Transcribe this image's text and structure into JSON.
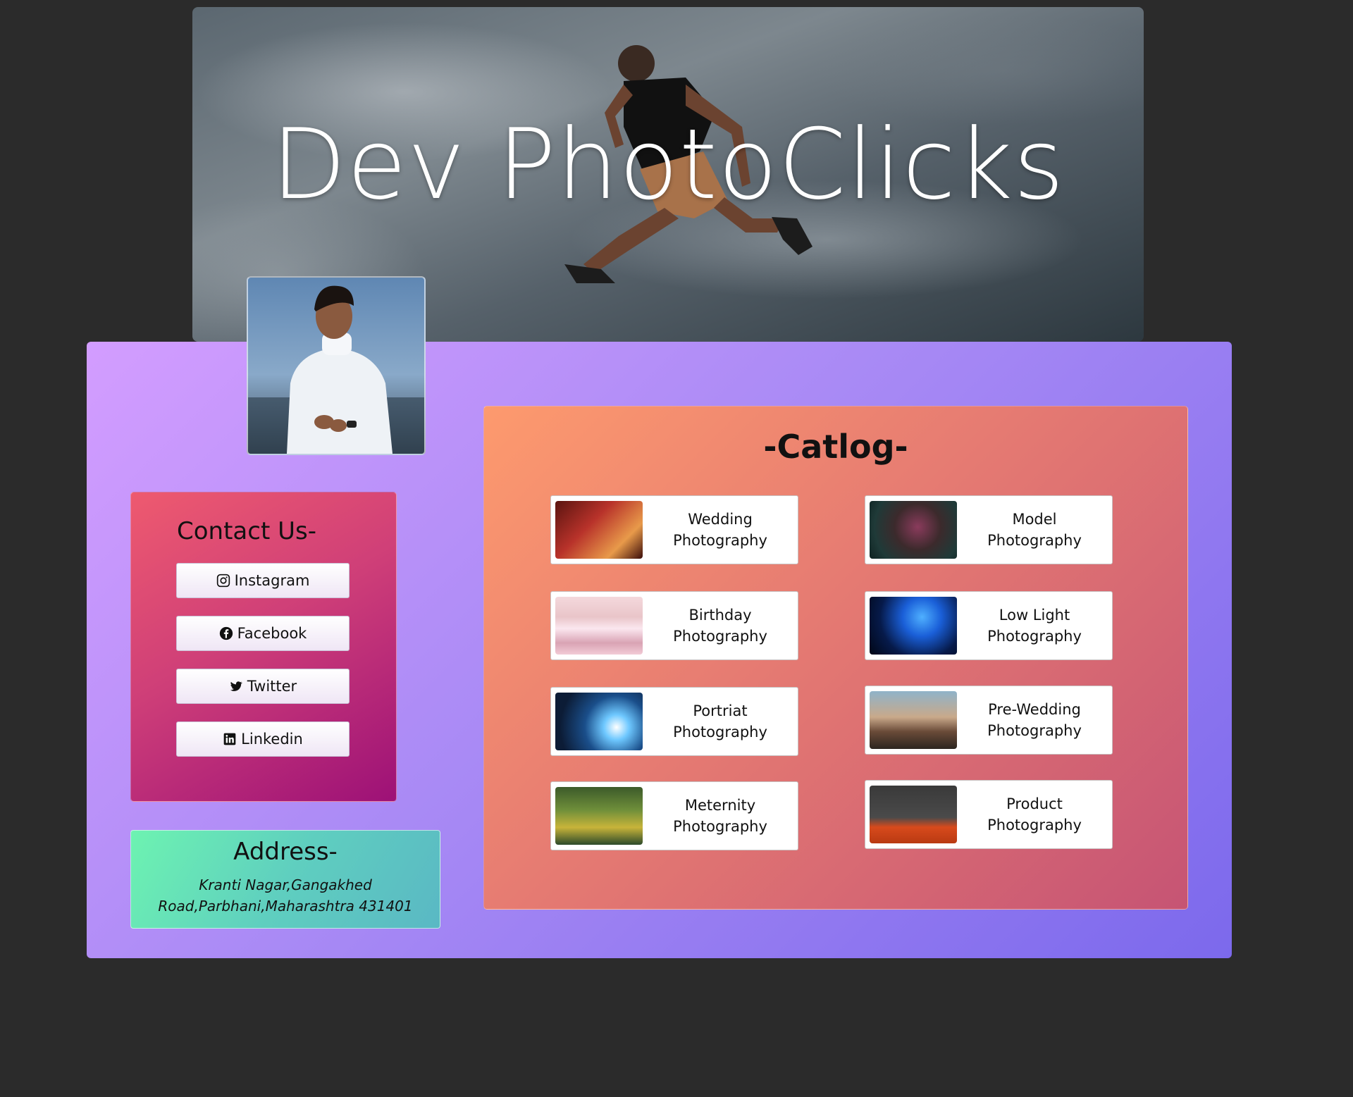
{
  "hero": {
    "title": "Dev PhotoClicks"
  },
  "contact": {
    "title": "Contact Us-",
    "buttons": [
      {
        "label": "Instagram",
        "icon": "instagram-icon"
      },
      {
        "label": "Facebook",
        "icon": "facebook-icon"
      },
      {
        "label": "Twitter",
        "icon": "twitter-icon"
      },
      {
        "label": "Linkedin",
        "icon": "linkedin-icon"
      }
    ]
  },
  "address": {
    "title": "Address-",
    "text": "Kranti Nagar,Gangakhed Road,Parbhani,Maharashtra 431401"
  },
  "catalog": {
    "title": "-Catlog-",
    "items": [
      {
        "line1": "Wedding",
        "line2": "Photography"
      },
      {
        "line1": "Model",
        "line2": "Photography"
      },
      {
        "line1": "Birthday",
        "line2": "Photography"
      },
      {
        "line1": "Low Light",
        "line2": "Photography"
      },
      {
        "line1": "Portriat",
        "line2": "Photography"
      },
      {
        "line1": "Pre-Wedding",
        "line2": "Photography"
      },
      {
        "line1": "Meternity",
        "line2": "Photography"
      },
      {
        "line1": "Product",
        "line2": "Photography"
      }
    ]
  },
  "colors": {
    "page_bg": "#2b2b2b",
    "panel_gradient_start": "#d39dff",
    "panel_gradient_end": "#7c69ec",
    "contact_gradient_start": "#ee5a6f",
    "contact_gradient_end": "#9d1177",
    "address_gradient_start": "#6df3b1",
    "address_gradient_end": "#5ab8c4",
    "catalog_gradient_start": "#fd9a6e",
    "catalog_gradient_end": "#c65474"
  }
}
